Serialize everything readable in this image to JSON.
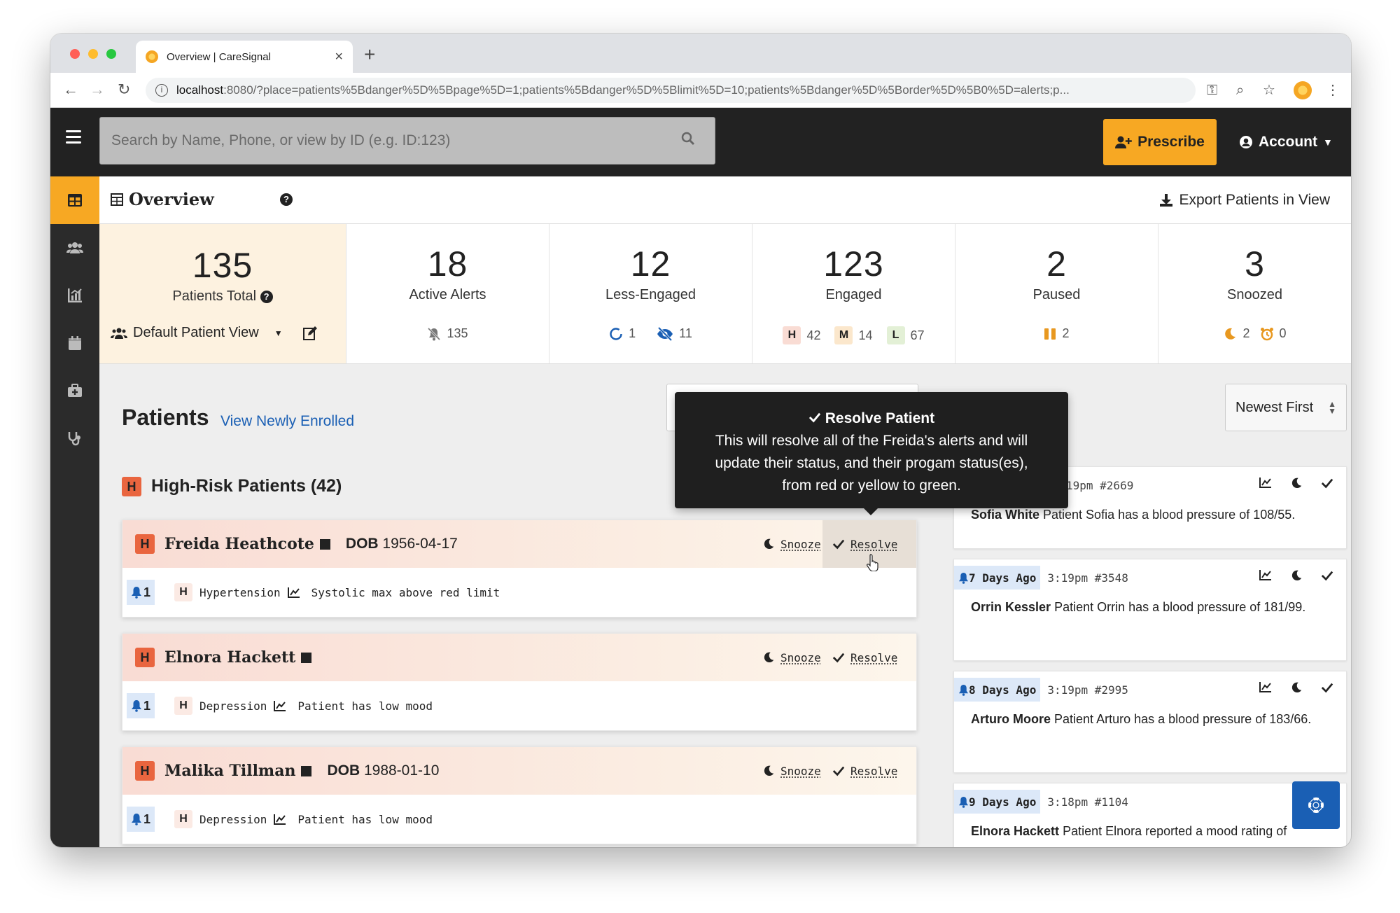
{
  "browser": {
    "tab_title": "Overview | CareSignal",
    "url_host": "localhost",
    "url_path": ":8080/?place=patients%5Bdanger%5D%5Bpage%5D=1;patients%5Bdanger%5D%5Blimit%5D=10;patients%5Bdanger%5D%5Border%5D%5B0%5D=alerts;p..."
  },
  "header": {
    "search_placeholder": "Search by Name, Phone, or view by ID (e.g. ID:123)",
    "prescribe_label": "Prescribe",
    "account_label": "Account"
  },
  "overview": {
    "title": "Overview",
    "export_label": "Export Patients in View"
  },
  "stats": {
    "total": {
      "num": "135",
      "label": "Patients Total",
      "view": "Default Patient View"
    },
    "alerts": {
      "num": "18",
      "label": "Active Alerts",
      "sub": "135"
    },
    "less": {
      "num": "12",
      "label": "Less-Engaged",
      "a": "1",
      "b": "11"
    },
    "engaged": {
      "num": "123",
      "label": "Engaged",
      "h": "H",
      "hv": "42",
      "m": "M",
      "mv": "14",
      "l": "L",
      "lv": "67"
    },
    "paused": {
      "num": "2",
      "label": "Paused",
      "sub": "2"
    },
    "snoozed": {
      "num": "3",
      "label": "Snoozed",
      "a": "2",
      "b": "0"
    }
  },
  "patients": {
    "heading": "Patients",
    "newly_link": "View Newly Enrolled",
    "sort_label": "Newest First",
    "risk_badge": "H",
    "risk_heading": "High-Risk Patients (42)",
    "cards": [
      {
        "badge": "H",
        "name": "Freida Heathcote",
        "dob_label": "DOB",
        "dob": "1956-04-17",
        "bell": "1",
        "cond_badge": "H",
        "condition": "Hypertension",
        "message": "Systolic max above red limit"
      },
      {
        "badge": "H",
        "name": "Elnora Hackett",
        "dob_label": "",
        "dob": "",
        "bell": "1",
        "cond_badge": "H",
        "condition": "Depression",
        "message": "Patient has low mood"
      },
      {
        "badge": "H",
        "name": "Malika Tillman",
        "dob_label": "DOB",
        "dob": "1988-01-10",
        "bell": "1",
        "cond_badge": "H",
        "condition": "Depression",
        "message": "Patient has low mood"
      }
    ],
    "snooze_label": "Snooze",
    "resolve_label": "Resolve"
  },
  "tooltip": {
    "title": "Resolve Patient",
    "line1": "This will resolve all of the Freida's alerts and will",
    "line2": "update their status, and their progam status(es),",
    "line3": "from red or yellow to green."
  },
  "alerts": [
    {
      "ago": "",
      "time": "19pm #2669",
      "name": "Sofia White",
      "text": "Patient Sofia has a blood pressure of 108/55."
    },
    {
      "ago": "7 Days Ago",
      "time": "3:19pm #3548",
      "name": "Orrin Kessler",
      "text": "Patient Orrin has a blood pressure of 181/99."
    },
    {
      "ago": "8 Days Ago",
      "time": "3:19pm #2995",
      "name": "Arturo Moore",
      "text": "Patient Arturo has a blood pressure of 183/66."
    },
    {
      "ago": "9 Days Ago",
      "time": "3:18pm #1104",
      "name": "Elnora Hackett",
      "text": "Patient Elnora reported a mood rating of"
    }
  ]
}
